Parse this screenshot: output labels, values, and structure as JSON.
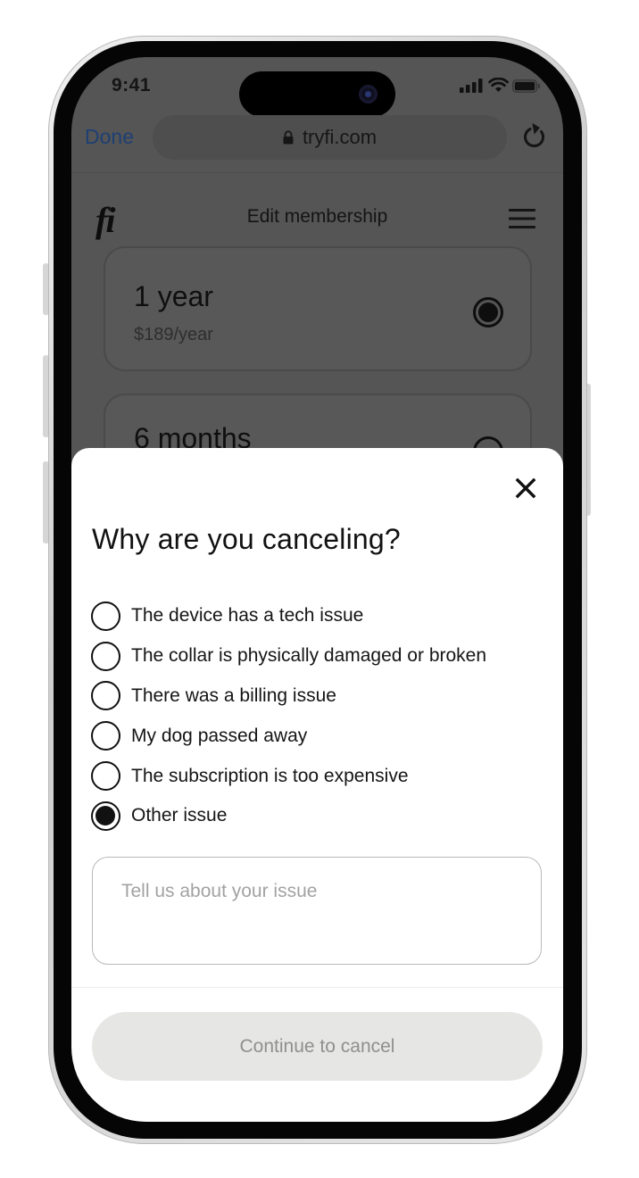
{
  "status_bar": {
    "time": "9:41"
  },
  "browser": {
    "done_label": "Done",
    "url": "tryfi.com"
  },
  "header": {
    "logo": "fi",
    "title": "Edit membership"
  },
  "plans": [
    {
      "name": "1 year",
      "price": "$189/year",
      "selected": true
    },
    {
      "name": "6 months",
      "selected": false
    }
  ],
  "modal": {
    "title": "Why are you canceling?",
    "reasons": [
      {
        "label": "The device has a tech issue",
        "selected": false
      },
      {
        "label": "The collar is physically damaged or broken",
        "selected": false
      },
      {
        "label": "There was a billing issue",
        "selected": false
      },
      {
        "label": "My dog passed away",
        "selected": false
      },
      {
        "label": "The subscription is too expensive",
        "selected": false
      },
      {
        "label": "Other issue",
        "selected": true
      }
    ],
    "issue_placeholder": "Tell us about your issue",
    "issue_value": "",
    "continue_label": "Continue to cancel"
  },
  "colors": {
    "overlay": "#555555",
    "sheet": "#ffffff",
    "done_link": "#1e3f73",
    "button_disabled_bg": "#e6e6e5",
    "button_disabled_text": "#8f8f8f"
  },
  "icons": [
    "signal-icon",
    "wifi-icon",
    "battery-icon",
    "lock-icon",
    "reload-icon",
    "menu-icon",
    "close-icon"
  ]
}
